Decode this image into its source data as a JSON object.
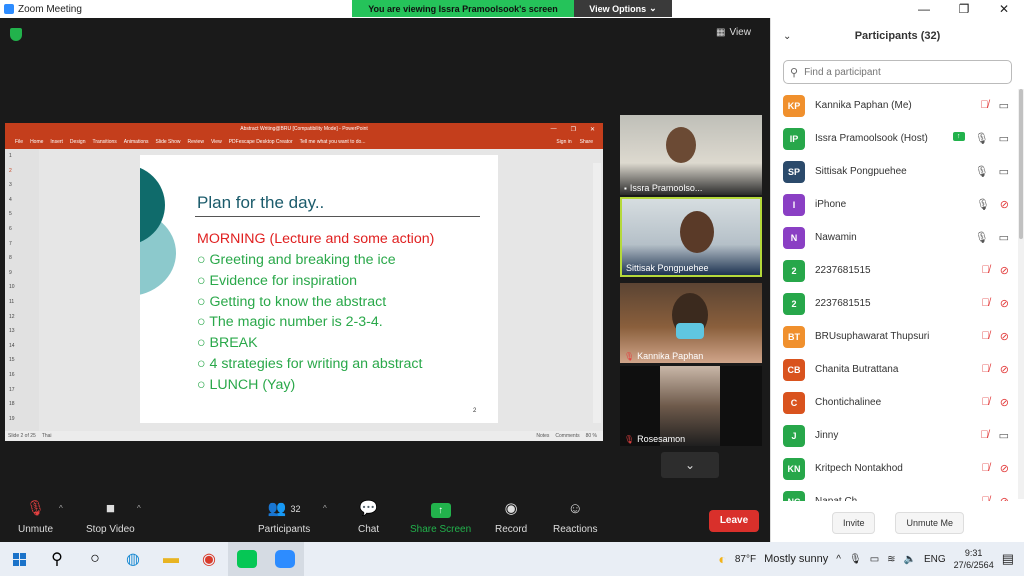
{
  "window": {
    "title": "Zoom Meeting"
  },
  "banner": {
    "text": "You are viewing Issra Pramoolsook's screen",
    "view_options": "View Options"
  },
  "view_button": {
    "label": "View"
  },
  "ppt": {
    "title": "Abstract Writing@BRU [Compatibility Mode] - PowerPoint",
    "menu": [
      "File",
      "Home",
      "Insert",
      "Design",
      "Transitions",
      "Animations",
      "Slide Show",
      "Review",
      "View",
      "PDFescape Desktop Creator",
      "Tell me what you want to do..."
    ],
    "sign_in": "Sign in",
    "share": "Share",
    "thumb_numbers": [
      "1",
      "2",
      "3",
      "4",
      "5",
      "6",
      "7",
      "8",
      "9",
      "10",
      "11",
      "12",
      "13",
      "14",
      "15",
      "16",
      "17",
      "18",
      "19"
    ],
    "slide": {
      "title": "Plan for the day..",
      "heading": "MORNING (Lecture and some action)",
      "items": [
        "○ Greeting and breaking the ice",
        "○ Evidence for inspiration",
        "○ Getting to know the abstract",
        "○ The magic number is 2-3-4.",
        "○ BREAK",
        "○ 4 strategies for writing an abstract",
        "○ LUNCH (Yay)"
      ],
      "number": "2"
    },
    "status": {
      "slide": "Slide 2 of 25",
      "lang": "Thai",
      "notes": "Notes",
      "comments": "Comments",
      "zoom": "80 %"
    }
  },
  "videos": [
    {
      "name": "Issra Pramoolso..."
    },
    {
      "name": "Sittisak Pongpuehee"
    },
    {
      "name": "Kannika Paphan"
    },
    {
      "name": "Rosesamon"
    }
  ],
  "toolbar": {
    "unmute": "Unmute",
    "stop_video": "Stop Video",
    "participants": "Participants",
    "participants_count": "32",
    "chat": "Chat",
    "share_screen": "Share Screen",
    "record": "Record",
    "reactions": "Reactions",
    "leave": "Leave"
  },
  "panel": {
    "title": "Participants (32)",
    "search_placeholder": "Find a participant",
    "invite": "Invite",
    "unmute_me": "Unmute Me",
    "participants": [
      {
        "initials": "KP",
        "name": "Kannika Paphan (Me)",
        "color": "#f0902d",
        "mic": "off",
        "video": "on",
        "share": false
      },
      {
        "initials": "IP",
        "name": "Issra Pramoolsook (Host)",
        "color": "#27a74a",
        "mic": "on",
        "video": "on",
        "share": true
      },
      {
        "initials": "SP",
        "name": "Sittisak Pongpuehee",
        "color": "#2b4a6b",
        "mic": "on",
        "video": "on",
        "share": false
      },
      {
        "initials": "I",
        "name": "iPhone",
        "color": "#8a3fc4",
        "mic": "on",
        "video": "off",
        "share": false
      },
      {
        "initials": "N",
        "name": "Nawamin",
        "color": "#8a3fc4",
        "mic": "on",
        "video": "on",
        "share": false
      },
      {
        "initials": "2",
        "name": "2237681515",
        "color": "#27a74a",
        "mic": "off",
        "video": "off",
        "share": false
      },
      {
        "initials": "2",
        "name": "2237681515",
        "color": "#27a74a",
        "mic": "off",
        "video": "off",
        "share": false
      },
      {
        "initials": "BT",
        "name": "BRUsuphawarat Thupsuri",
        "color": "#f0902d",
        "mic": "off",
        "video": "off",
        "share": false
      },
      {
        "initials": "CB",
        "name": "Chanita Butrattana",
        "color": "#d9531e",
        "mic": "off",
        "video": "off",
        "share": false
      },
      {
        "initials": "C",
        "name": "Chontichalinee",
        "color": "#d9531e",
        "mic": "off",
        "video": "off",
        "share": false
      },
      {
        "initials": "J",
        "name": "Jinny",
        "color": "#27a74a",
        "mic": "off",
        "video": "on",
        "share": false
      },
      {
        "initials": "KN",
        "name": "Kritpech Nontakhod",
        "color": "#27a74a",
        "mic": "off",
        "video": "off",
        "share": false
      },
      {
        "initials": "NC",
        "name": "Napat Ch...",
        "color": "#27a74a",
        "mic": "off",
        "video": "off",
        "share": false
      }
    ]
  },
  "taskbar": {
    "weather_temp": "87°F",
    "weather_desc": "Mostly sunny",
    "lang": "ENG",
    "time": "9:31",
    "date": "27/6/2564"
  }
}
